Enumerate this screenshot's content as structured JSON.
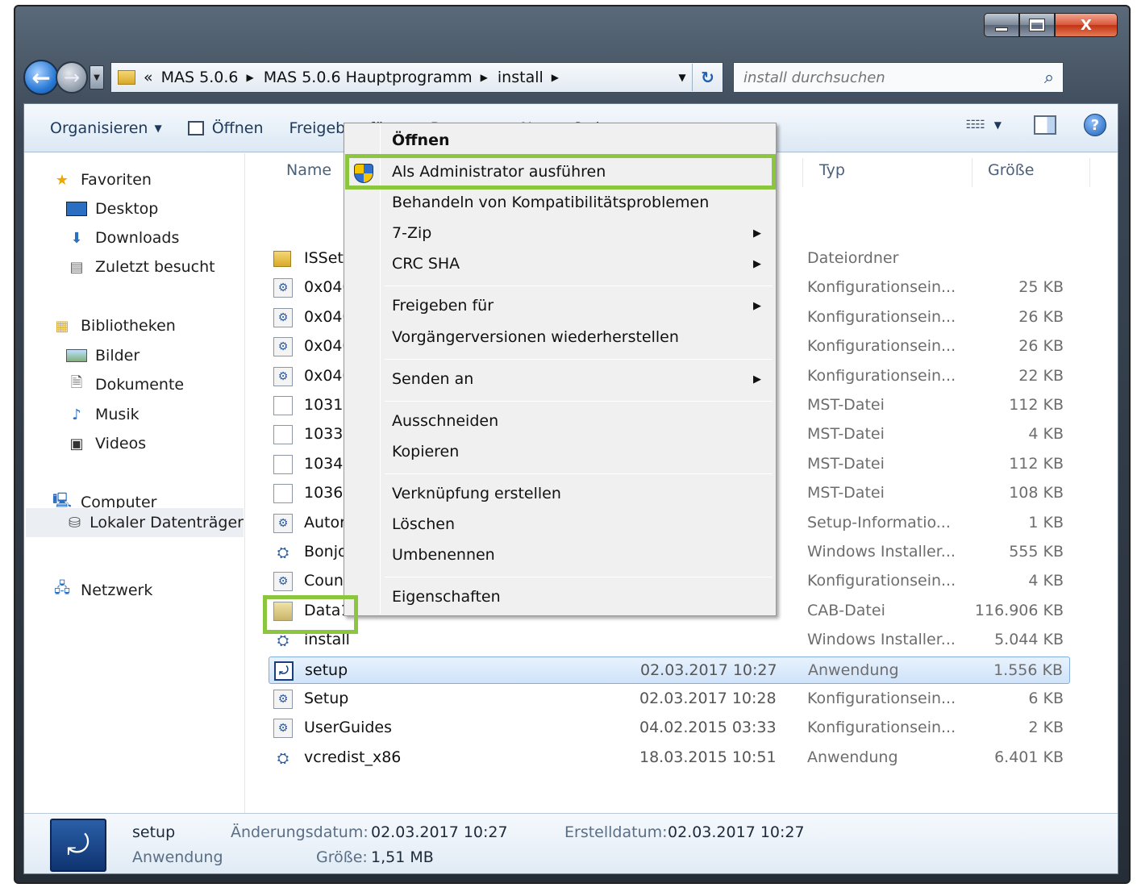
{
  "window": {
    "controls": {
      "minimize": "–",
      "maximize": "□",
      "close": "X"
    }
  },
  "nav": {
    "back_icon": "arrow-left-icon",
    "forward_icon": "arrow-right-icon",
    "breadcrumb_overflow": "«",
    "breadcrumbs": [
      "MAS 5.0.6",
      "MAS 5.0.6 Hauptprogramm",
      "install"
    ],
    "search_placeholder": "install durchsuchen"
  },
  "toolbar": {
    "organize": "Organisieren",
    "open": "Öffnen",
    "share": "Freigeben für",
    "burn": "Brennen",
    "new_folder": "Neuer Ordner"
  },
  "sidebar": {
    "favorites": "Favoriten",
    "desktop": "Desktop",
    "downloads": "Downloads",
    "recent": "Zuletzt besucht",
    "libraries": "Bibliotheken",
    "pictures": "Bilder",
    "documents": "Dokumente",
    "music": "Musik",
    "videos": "Videos",
    "computer": "Computer",
    "local_disk": "Lokaler Datenträger",
    "network": "Netzwerk"
  },
  "columns": {
    "name": "Name",
    "type": "Typ",
    "size": "Größe"
  },
  "files": [
    {
      "name": "ISSetu",
      "date": "",
      "type": "Dateiordner",
      "size": "",
      "icon": "folder"
    },
    {
      "name": "0x040",
      "date": "",
      "type": "Konfigurationsein...",
      "size": "25 KB",
      "icon": "conf"
    },
    {
      "name": "0x040",
      "date": "",
      "type": "Konfigurationsein...",
      "size": "26 KB",
      "icon": "conf"
    },
    {
      "name": "0x040",
      "date": "",
      "type": "Konfigurationsein...",
      "size": "26 KB",
      "icon": "conf"
    },
    {
      "name": "0x040",
      "date": "",
      "type": "Konfigurationsein...",
      "size": "22 KB",
      "icon": "conf"
    },
    {
      "name": "1031.r",
      "date": "",
      "type": "MST-Datei",
      "size": "112 KB",
      "icon": "blank"
    },
    {
      "name": "1033.r",
      "date": "",
      "type": "MST-Datei",
      "size": "4 KB",
      "icon": "blank"
    },
    {
      "name": "1034.r",
      "date": "",
      "type": "MST-Datei",
      "size": "112 KB",
      "icon": "blank"
    },
    {
      "name": "1036.r",
      "date": "",
      "type": "MST-Datei",
      "size": "108 KB",
      "icon": "blank"
    },
    {
      "name": "Autor",
      "date": "",
      "type": "Setup-Informatio...",
      "size": "1 KB",
      "icon": "conf"
    },
    {
      "name": "Bonjo",
      "date": "",
      "type": "Windows Installer...",
      "size": "555 KB",
      "icon": "msi"
    },
    {
      "name": "Coun",
      "date": "",
      "type": "Konfigurationsein...",
      "size": "4 KB",
      "icon": "conf"
    },
    {
      "name": "Data1",
      "date": "",
      "type": "CAB-Datei",
      "size": "116.906 KB",
      "icon": "cab"
    },
    {
      "name": "install",
      "date": "",
      "type": "Windows Installer...",
      "size": "5.044 KB",
      "icon": "msi"
    },
    {
      "name": "setup",
      "date": "02.03.2017 10:27",
      "type": "Anwendung",
      "size": "1.556 KB",
      "icon": "app"
    },
    {
      "name": "Setup",
      "date": "02.03.2017 10:28",
      "type": "Konfigurationsein...",
      "size": "6 KB",
      "icon": "conf"
    },
    {
      "name": "UserGuides",
      "date": "04.02.2015 03:33",
      "type": "Konfigurationsein...",
      "size": "2 KB",
      "icon": "conf"
    },
    {
      "name": "vcredist_x86",
      "date": "18.03.2015 10:51",
      "type": "Anwendung",
      "size": "6.401 KB",
      "icon": "msi"
    }
  ],
  "context_menu": {
    "open": "Öffnen",
    "run_as_admin": "Als Administrator ausführen",
    "compat": "Behandeln von Kompatibilitätsproblemen",
    "zip": "7-Zip",
    "crc": "CRC SHA",
    "share": "Freigeben für",
    "restore": "Vorgängerversionen wiederherstellen",
    "send_to": "Senden an",
    "cut": "Ausschneiden",
    "copy": "Kopieren",
    "shortcut": "Verknüpfung erstellen",
    "delete": "Löschen",
    "rename": "Umbenennen",
    "properties": "Eigenschaften"
  },
  "details": {
    "name": "setup",
    "kind": "Anwendung",
    "modified_label": "Änderungsdatum:",
    "modified_value": "02.03.2017 10:27",
    "created_label": "Erstelldatum:",
    "created_value": "02.03.2017 10:27",
    "size_label": "Größe:",
    "size_value": "1,51 MB"
  },
  "colors": {
    "highlight": "#8cc63f",
    "selection": "#cfe3fa"
  }
}
